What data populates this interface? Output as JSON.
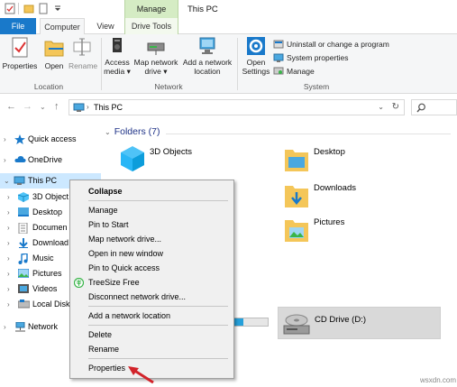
{
  "window": {
    "title": "This PC",
    "context_tab": "Manage"
  },
  "tabs": {
    "file": "File",
    "computer": "Computer",
    "view": "View",
    "drive_tools": "Drive Tools"
  },
  "ribbon": {
    "location": {
      "label": "Location",
      "properties": "Properties",
      "open": "Open",
      "rename": "Rename"
    },
    "network": {
      "label": "Network",
      "access_media_1": "Access",
      "access_media_2": "media",
      "map_drive_1": "Map network",
      "map_drive_2": "drive",
      "add_location_1": "Add a network",
      "add_location_2": "location"
    },
    "system": {
      "label": "System",
      "open_settings_1": "Open",
      "open_settings_2": "Settings",
      "uninstall": "Uninstall or change a program",
      "system_properties": "System properties",
      "manage": "Manage"
    }
  },
  "address": {
    "path": "This PC"
  },
  "nav": {
    "quick_access": "Quick access",
    "onedrive": "OneDrive",
    "this_pc": "This PC",
    "items": [
      "3D Object",
      "Desktop",
      "Documen",
      "Download",
      "Music",
      "Pictures",
      "Videos",
      "Local Disk"
    ],
    "network": "Network"
  },
  "main": {
    "folders_header": "Folders (7)",
    "folders": [
      "3D Objects",
      "Desktop",
      "Downloads",
      "Pictures"
    ],
    "cd_drive": "CD Drive (D:)",
    "disk_usage_fraction": 0.3
  },
  "context_menu": {
    "collapse": "Collapse",
    "manage": "Manage",
    "pin_start": "Pin to Start",
    "map_drive": "Map network drive...",
    "open_new_window": "Open in new window",
    "pin_quick": "Pin to Quick access",
    "treesize": "TreeSize Free",
    "disconnect": "Disconnect network drive...",
    "add_location": "Add a network location",
    "delete": "Delete",
    "rename": "Rename",
    "properties": "Properties"
  },
  "watermark": "wsxdn.com",
  "colors": {
    "accent": "#1979ca",
    "manage_tab": "#d5ecc4",
    "folder_yellow": "#f4c659",
    "arrow_red": "#d2232a",
    "selection": "#cce8ff"
  }
}
